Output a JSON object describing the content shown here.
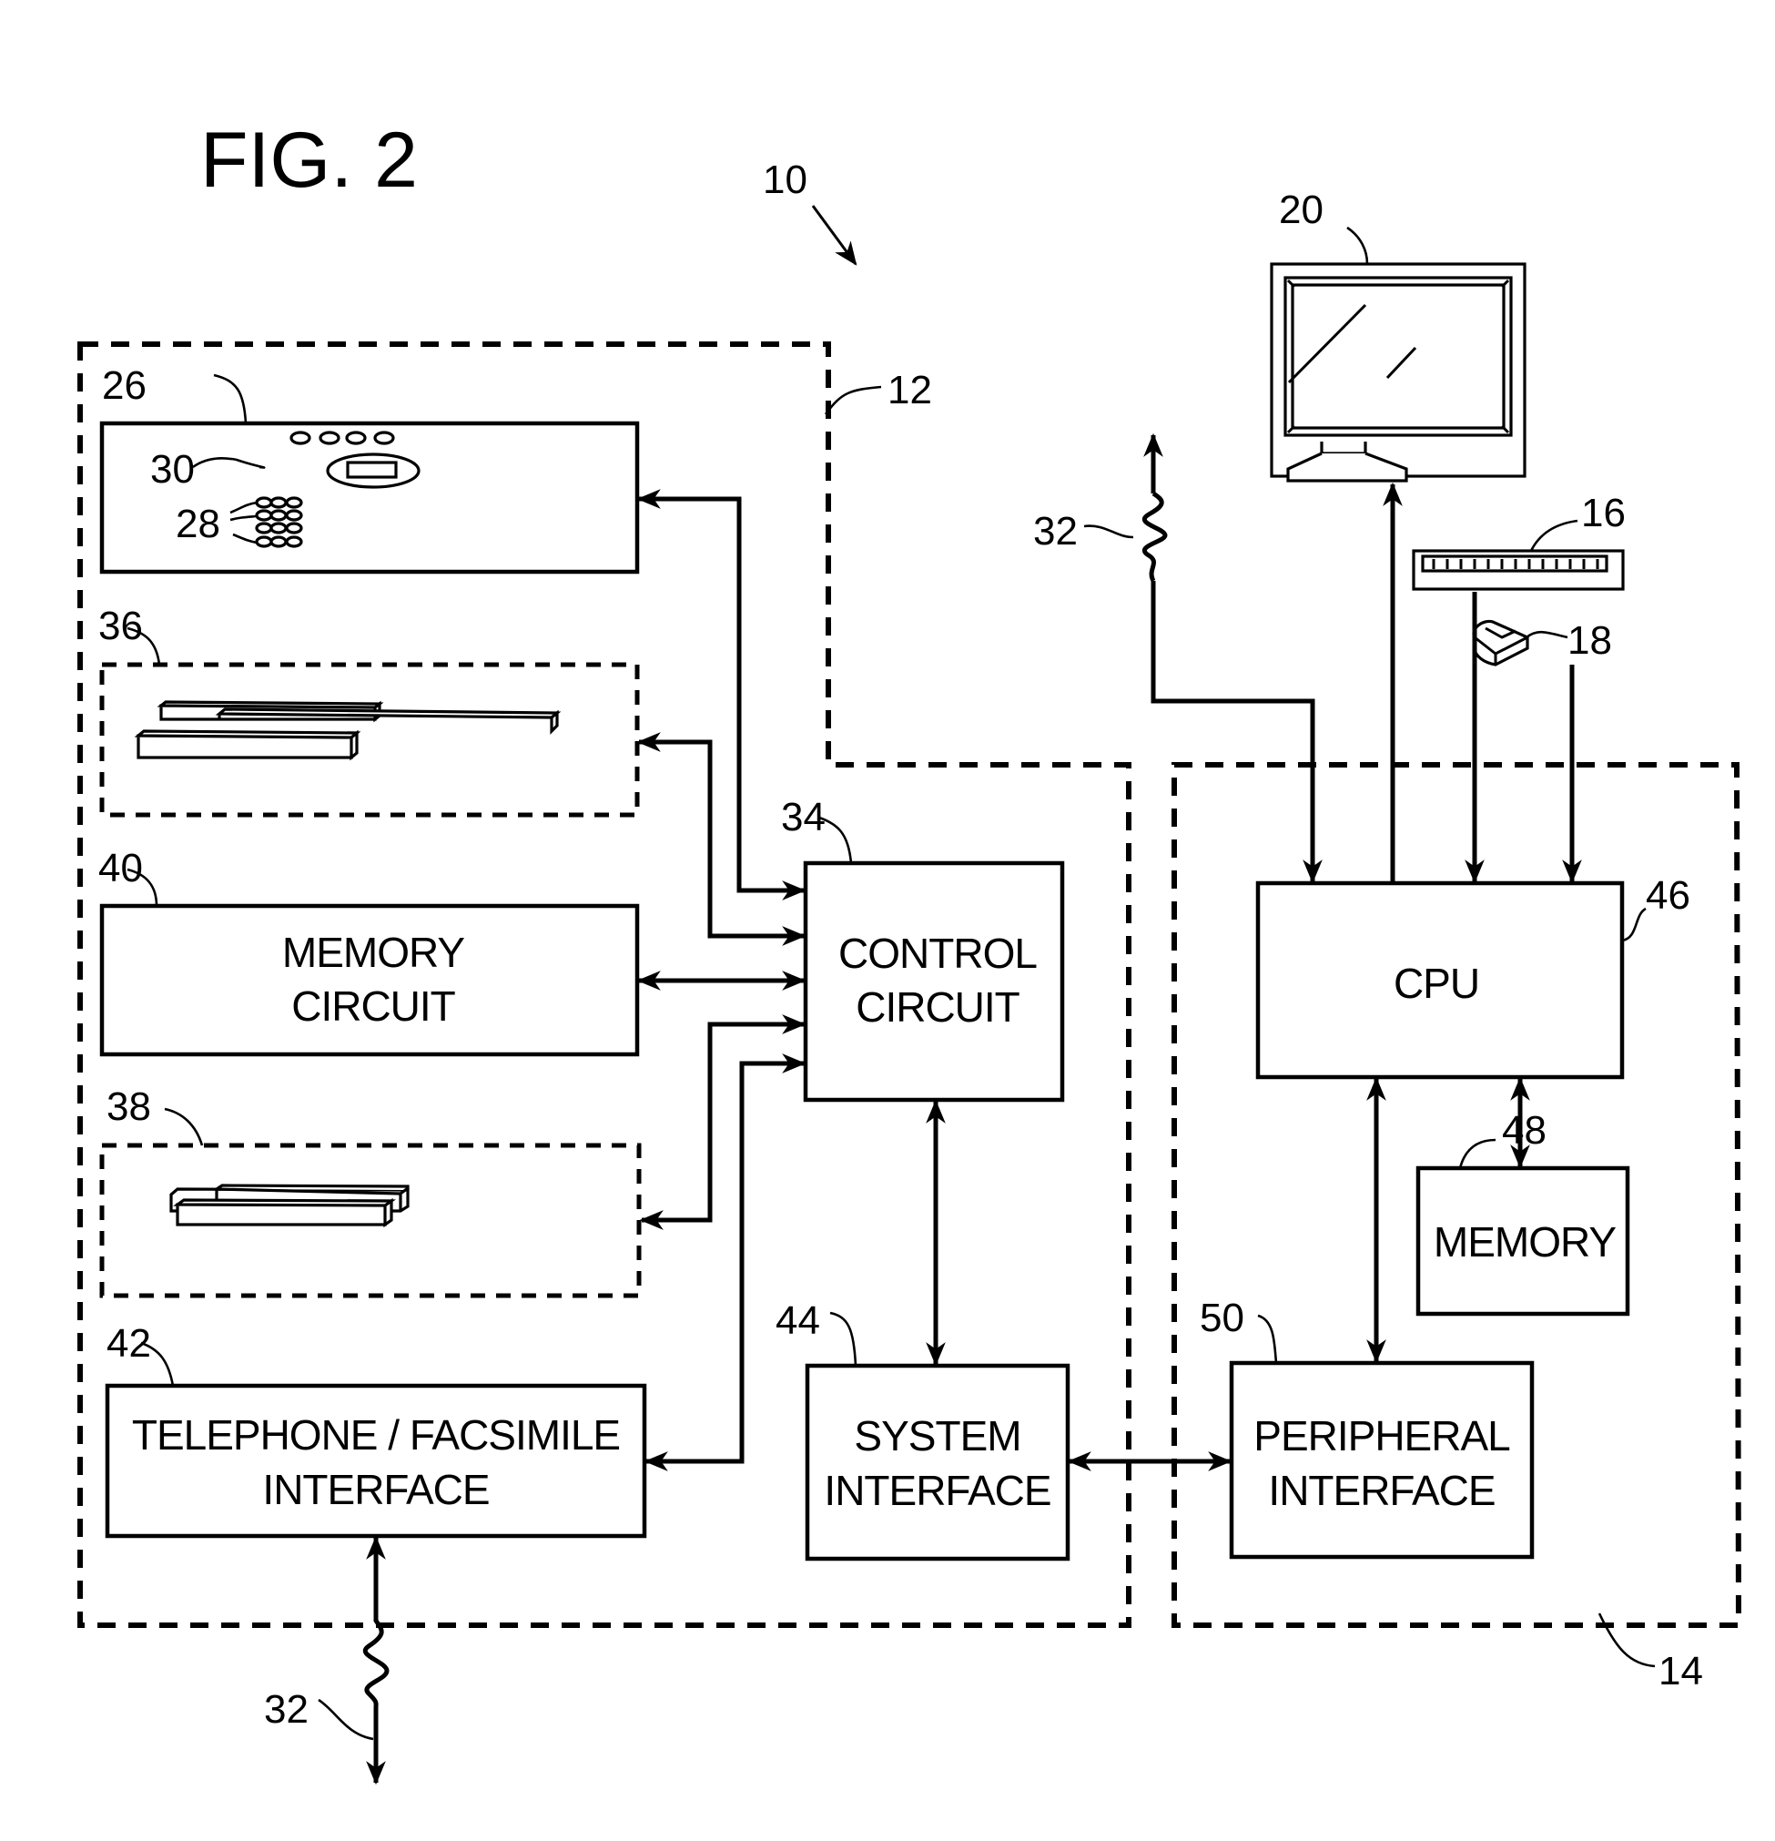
{
  "figure": {
    "title": "FIG. 2",
    "system_ref": "10"
  },
  "blocks": {
    "printer_unit": {
      "ref": "26",
      "display_ref": "30",
      "keypad_ref": "28"
    },
    "drive_36": {
      "ref": "36"
    },
    "memory_circuit": {
      "ref": "40",
      "line1": "MEMORY",
      "line2": "CIRCUIT"
    },
    "drive_38": {
      "ref": "38"
    },
    "telephone_facsimile_interface": {
      "ref": "42",
      "line1": "TELEPHONE / FACSIMILE",
      "line2": "INTERFACE"
    },
    "control_circuit": {
      "ref": "34",
      "line1": "CONTROL",
      "line2": "CIRCUIT"
    },
    "system_interface": {
      "ref": "44",
      "line1": "SYSTEM",
      "line2": "INTERFACE"
    },
    "cpu": {
      "ref": "46",
      "label": "CPU"
    },
    "memory": {
      "ref": "48",
      "label": "MEMORY"
    },
    "peripheral_interface": {
      "ref": "50",
      "line1": "PERIPHERAL",
      "line2": "INTERFACE"
    }
  },
  "enclosures": {
    "multifunction_device": {
      "ref": "12"
    },
    "computer": {
      "ref": "14"
    }
  },
  "peripherals": {
    "monitor": {
      "ref": "20"
    },
    "keyboard": {
      "ref": "16"
    },
    "mouse": {
      "ref": "18"
    }
  },
  "links": {
    "network_top": {
      "ref": "32"
    },
    "network_bottom": {
      "ref": "32"
    }
  }
}
